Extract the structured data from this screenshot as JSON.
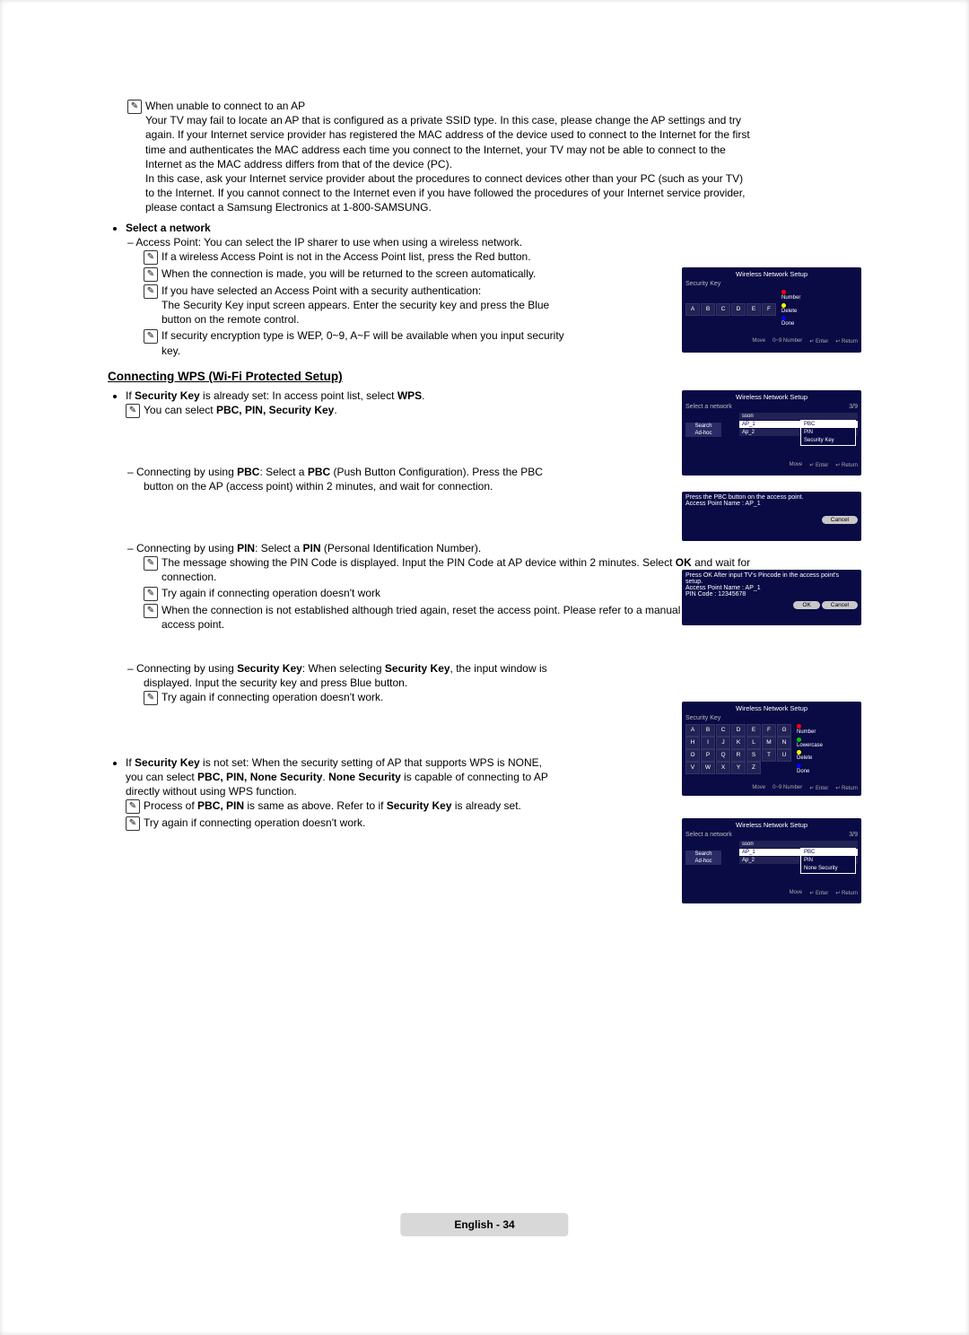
{
  "intro": {
    "unable_title": "When unable to connect to an AP",
    "unable_para1": "Your TV may fail to locate an AP that is configured as a private SSID type. In this case, please change the AP settings and try again. If your Internet service provider has registered the MAC address of the device used to connect to the Internet for the first time and authenticates the MAC address each time you connect to the Internet, your TV may not be able to connect to the Internet as the MAC address differs from that of the device (PC).",
    "unable_para2": "In this case, ask your Internet service provider about the procedures to connect devices other than your PC (such as your TV) to the Internet. If you cannot connect to the Internet even if you have followed the procedures of your Internet service provider, please contact a Samsung Electronics at 1-800-SAMSUNG."
  },
  "select_net": {
    "label": "Select a network",
    "ap_line": "Access Point: You can select the IP sharer to use when using a wireless network.",
    "n1": "If a wireless Access Point is not in the Access Point list, press the Red button.",
    "n2": "When the connection is made, you will be returned to the screen automatically.",
    "n3a": "If you have selected an Access Point with a security authentication:",
    "n3b": "The Security Key input screen appears. Enter the security key and press the Blue button on the remote control.",
    "n4": "If security encryption type is WEP, 0~9, A~F will be available when you input security key."
  },
  "wps": {
    "heading": "Connecting WPS (Wi-Fi Protected Setup)",
    "if_set_prefix": "If ",
    "if_set_bold": "Security Key",
    "if_set_mid": " is already set: In access point list, select ",
    "if_set_wps": "WPS",
    "if_set_suffix": ".",
    "you_can": "You can select ",
    "you_can_bold": "PBC, PIN, Security Key",
    "you_can_suffix": ".",
    "pbc_prefix": "Connecting by using ",
    "pbc_bold": "PBC",
    "pbc_mid": ": Select a ",
    "pbc_bold2": "PBC",
    "pbc_suffix": " (Push Button Configuration). Press the PBC button on the AP (access point) within 2 minutes, and wait for connection.",
    "pin_prefix": "Connecting by using ",
    "pin_bold": "PIN",
    "pin_mid": ": Select a ",
    "pin_bold2": "PIN",
    "pin_suffix": " (Personal Identification Number).",
    "pin_msg": "The message showing the PIN Code is displayed. Input the PIN Code at AP device within 2 minutes. Select ",
    "pin_ok": "OK",
    "pin_msg_suffix": " and wait for connection.",
    "try_again": "Try again if connecting operation doesn't work",
    "reset_ap": "When the connection is not established although tried again, reset the access point. Please refer to a manual of each access point.",
    "sk_prefix": "Connecting by using ",
    "sk_bold": "Security Key",
    "sk_mid": ": When selecting ",
    "sk_bold2": "Security Key",
    "sk_suffix": ", the input window is displayed. Input the security key and press Blue button.",
    "try_again2": "Try again if connecting operation doesn't work.",
    "not_set_prefix": "If ",
    "not_set_bold": "Security Key",
    "not_set_mid": " is not set: When the security setting of AP that supports WPS is NONE, you can select ",
    "not_set_opts": "PBC, PIN, None Security",
    "not_set_mid2": ". ",
    "not_set_none": "None Security",
    "not_set_suffix": " is capable of connecting to AP directly without using WPS function.",
    "process": "Process of ",
    "process_bold": "PBC, PIN",
    "process_mid": " is same as above. Refer to if ",
    "process_bold2": "Security Key",
    "process_suffix": " is already set.",
    "try_again3": "Try again if connecting operation doesn't work."
  },
  "shots": {
    "s1": {
      "title": "Wireless Network Setup",
      "sub": "Security Key",
      "keys": [
        "A",
        "B",
        "C",
        "D",
        "E",
        "F"
      ],
      "leg1": "Number",
      "leg2": "Delete",
      "leg3": "Done",
      "bar": [
        "Move",
        "0~9 Number",
        "↵ Enter",
        "↩ Return"
      ]
    },
    "s2": {
      "title": "Wireless Network Setup",
      "label": "Select a network",
      "count": "3/9",
      "left": [
        "Search",
        "Ad-hoc"
      ],
      "aps": [
        "sson",
        "AP_1",
        "Ap_2"
      ],
      "pop": [
        "PBC",
        "PIN",
        "Security Key"
      ],
      "bar": [
        "Move",
        "↵ Enter",
        "↩ Return"
      ]
    },
    "s3": {
      "line1": "Press the PBC button on the access point.",
      "line2": "Access Point Name : AP_1",
      "cancel": "Cancel"
    },
    "s4": {
      "line1": "Press OK After input TV's Pincode in the access point's setup.",
      "line2": "Access Point Name : AP_1",
      "line3": "PIN Code : 12345678",
      "ok": "OK",
      "cancel": "Cancel"
    },
    "s5": {
      "title": "Wireless Network Setup",
      "sub": "Security Key",
      "rows": [
        [
          "A",
          "B",
          "C",
          "D",
          "E",
          "F",
          "G"
        ],
        [
          "H",
          "I",
          "J",
          "K",
          "L",
          "M",
          "N"
        ],
        [
          "O",
          "P",
          "Q",
          "R",
          "S",
          "T",
          "U"
        ],
        [
          "V",
          "W",
          "X",
          "Y",
          "Z",
          "",
          ""
        ]
      ],
      "leg1": "Number",
      "leg2": "Lowercase",
      "leg3": "Delete",
      "leg4": "Done",
      "bar": [
        "Move",
        "0~9 Number",
        "↵ Enter",
        "↩ Return"
      ]
    },
    "s6": {
      "title": "Wireless Network Setup",
      "label": "Select a network",
      "count": "3/9",
      "left": [
        "Search",
        "Ad-hoc"
      ],
      "aps": [
        "sson",
        "AP_1",
        "Ap_2"
      ],
      "pop": [
        "PBC",
        "PIN",
        "None Security"
      ],
      "bar": [
        "Move",
        "↵ Enter",
        "↩ Return"
      ]
    }
  },
  "footer": "English - 34"
}
